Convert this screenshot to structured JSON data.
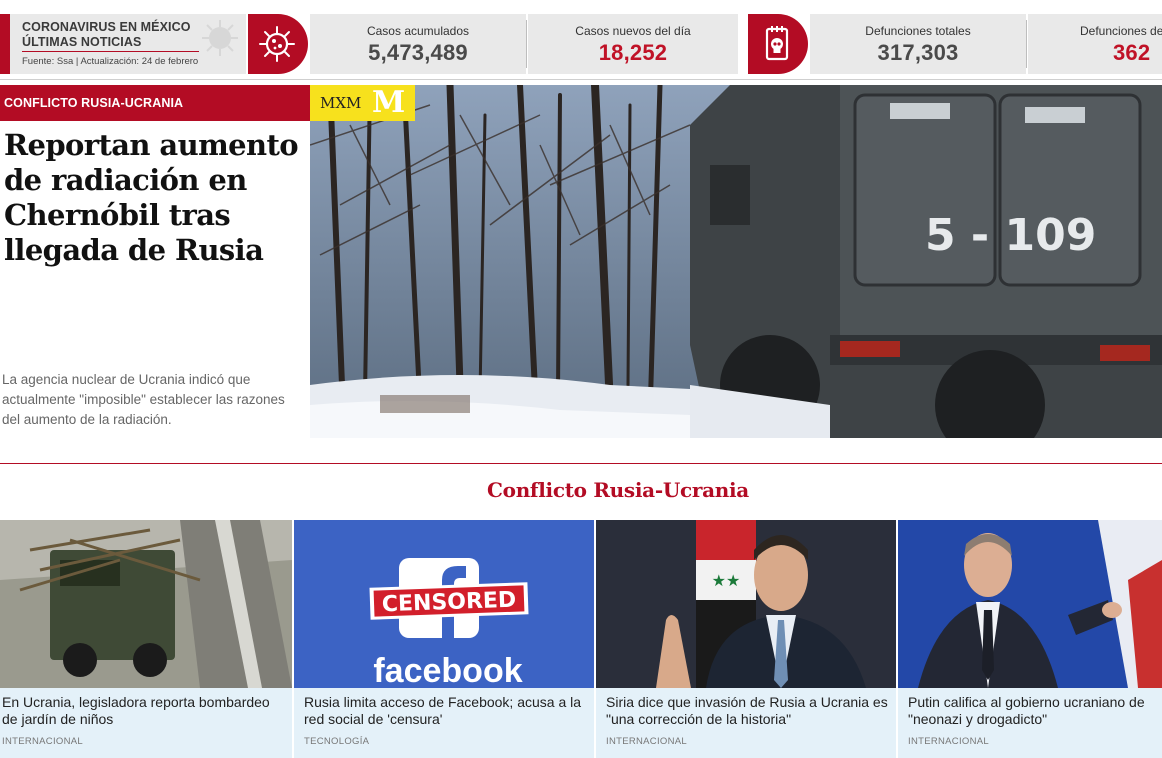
{
  "ticker": {
    "heading": "CORONAVIRUS EN MÉXICO\nÚLTIMAS NOTICIAS",
    "source": "Fuente: Ssa | Actualización: 24 de febrero",
    "stats": [
      {
        "label": "Casos acumulados",
        "value": "5,473,489"
      },
      {
        "label": "Casos nuevos del día",
        "value": "18,252"
      },
      {
        "label": "Defunciones totales",
        "value": "317,303"
      },
      {
        "label": "Defunciones de",
        "value": "362"
      }
    ],
    "accent": "#b30c24"
  },
  "hero": {
    "tag": "CONFLICTO RUSIA-UCRANIA",
    "title": "Reportan aumento de radiación en Chernóbil tras llegada de Rusia",
    "summary": "La agencia nuclear de Ucrania indicó que actualmente \"imposible\" establecer las razones del aumento de la radiación.",
    "badge": "MXM",
    "badge_mark": "M",
    "vehicle_number": "5 - 109"
  },
  "section": {
    "title": "Conflicto Rusia-Ucrania"
  },
  "cards": [
    {
      "title": "En Ucrania, legisladora reporta bombardeo de jardín de niños",
      "section": "INTERNACIONAL"
    },
    {
      "title": "Rusia limita acceso de Facebook; acusa a la red social de 'censura'",
      "section": "TECNOLOGÍA",
      "img_text_1": "CENSORED",
      "img_text_2": "facebook"
    },
    {
      "title": "Siria dice que invasión de Rusia a Ucrania es \"una corrección de la historia\"",
      "section": "INTERNACIONAL"
    },
    {
      "title": "Putin califica al gobierno ucraniano de \"neonazi y drogadicto\"",
      "section": "INTERNACIONAL"
    }
  ]
}
